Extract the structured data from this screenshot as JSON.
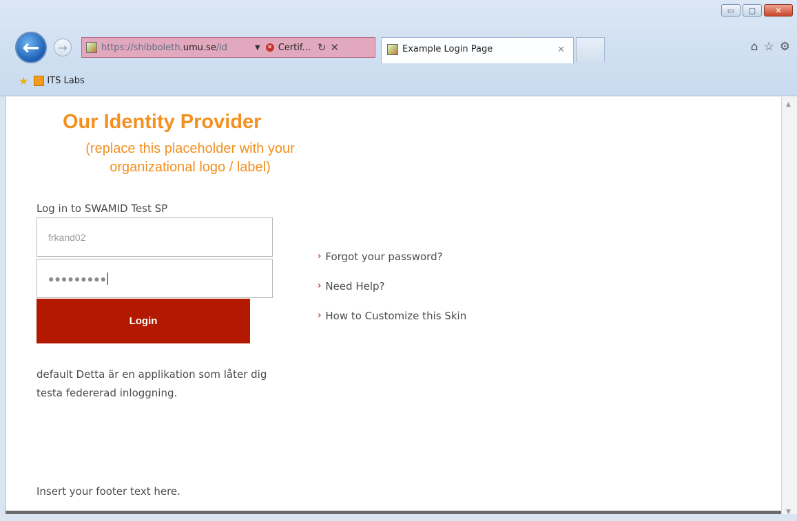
{
  "browser": {
    "address": {
      "url_prefix": "https://shibboleth.",
      "url_domain": "umu.se",
      "url_suffix": "/id",
      "cert_label": "Certif...",
      "cert_icon": "error-x-icon"
    },
    "tab": {
      "title": "Example Login Page",
      "close": "✕"
    },
    "window_buttons": {
      "minimize": "▭",
      "maximize": "▢",
      "close": "✕"
    },
    "tools": {
      "home": "⌂",
      "favorites": "☆",
      "settings": "⚙"
    },
    "favorites_bar": {
      "item": "ITS Labs"
    },
    "accent": "#1a5fb4"
  },
  "page": {
    "logo_title": "Our Identity Provider",
    "logo_subtitle": "(replace this placeholder with your organizational logo / label)",
    "login_heading": "Log in to SWAMID Test SP",
    "username_value": "frkand02",
    "password_value": "●●●●●●●●●",
    "login_button": "Login",
    "description": "default Detta är en applikation som låter dig testa federerad inloggning.",
    "links": [
      "Forgot your password?",
      "Need Help?",
      "How to Customize this Skin"
    ],
    "footer": "Insert your footer text here.",
    "colors": {
      "logo": "#f39020",
      "button": "#b31800"
    }
  }
}
